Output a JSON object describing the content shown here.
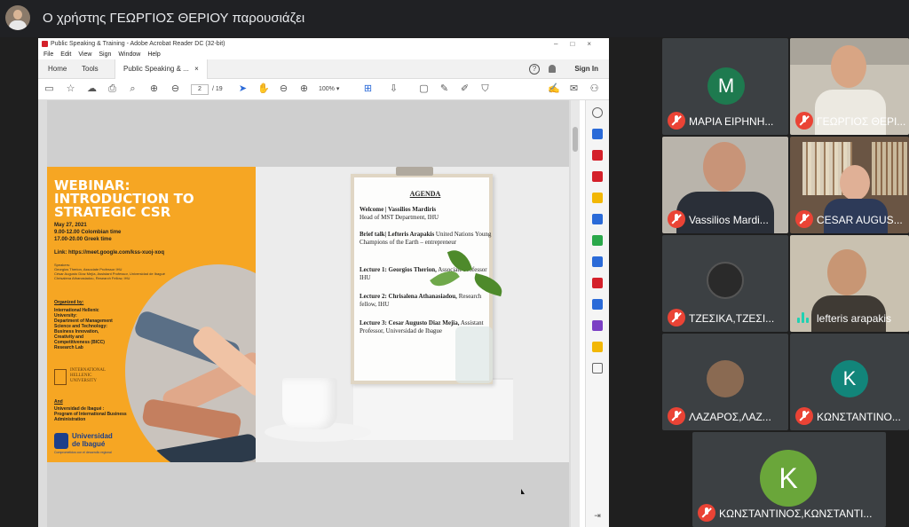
{
  "presenter": {
    "title": "Ο χρήστης ΓΕΩΡΓΙΟΣ ΘΕΡΙΟΥ παρουσιάζει"
  },
  "acrobat": {
    "window_title": "Public Speaking & Training - Adobe Acrobat Reader DC (32-bit)",
    "menu": [
      "File",
      "Edit",
      "View",
      "Sign",
      "Window",
      "Help"
    ],
    "tabs": {
      "home": "Home",
      "tools": "Tools",
      "doc": "Public Speaking & ...",
      "doc_close": "×"
    },
    "sign_in": "Sign In",
    "page_current": "2",
    "page_total": "/ 19",
    "zoom": "100%"
  },
  "poster": {
    "title_lines": [
      "WEBINAR:",
      "INTRODUCTION TO",
      "STRATEGIC CSR"
    ],
    "date": "May 27, 2021",
    "time1": "9.00-12.00 Colombian time",
    "time2": "17.00-20.00 Greek time",
    "link": "Link: https://meet.google.com/kss-xuoj-xoq",
    "speakers_lines": [
      "Speakers:",
      "Georgios Therion, Associate Professor IHU",
      "César Augusto Díaz Mejía, Assistant Professor, Universidad de Ibagué",
      "Chrisalena Athanasiadou, Research Fellow, IHU"
    ],
    "organized_by": "Organized by:",
    "org_lines": [
      "International Hellenic",
      "University:",
      "Department of Management",
      "Science  and Technology:",
      "Business Innovation,",
      "Creativity and",
      "Competitiveness (BICC)",
      "Research Lab"
    ],
    "ihu_logo_text": [
      "INTERNATIONAL",
      "HELLENIC",
      "UNIVERSITY"
    ],
    "and": "And",
    "and_lines": [
      "Universidad de Ibagué :",
      "Program of International Business",
      "Administration"
    ],
    "ibague_logo_text": [
      "Universidad",
      "de Ibagué"
    ],
    "ibague_tagline": "Comprometidos con el desarrollo regional"
  },
  "agenda": {
    "heading": "AGENDA",
    "items": [
      {
        "bold": "Welcome | Vassilios Mardiris",
        "rest": "Head of MST Department, IHU"
      },
      {
        "bold": "Brief talk| Lefteris Arapakis",
        "rest": "United Nations Young Champions of the Earth – entrepreneur"
      },
      {
        "bold": "Lecture 1: Georgios Therion,",
        "rest": "Associate Professor IHU"
      },
      {
        "bold": "Lecture 2: Chrisalena Athanasiadou,",
        "rest": "Research fellow, IHU"
      },
      {
        "bold": "Lecture 3: Cesar Augusto Diaz Mejia,",
        "rest": "Assistant Professor, Universidad de Ibague"
      }
    ]
  },
  "participants": [
    {
      "name": "ΜΑΡΙΑ ΕΙΡΗΝΗ...",
      "letter": "M",
      "avatar_color": "#1e7a4f",
      "muted": true
    },
    {
      "name": "ΓΕΩΡΓΙΟΣ ΘΕΡΙ...",
      "letter": "",
      "muted": true
    },
    {
      "name": "Vassilios Mardi...",
      "letter": "",
      "muted": true
    },
    {
      "name": "CESAR AUGUS...",
      "letter": "",
      "muted": true
    },
    {
      "name": "ΤΖΕΣΙΚΑ,ΤΖΕΣΙ...",
      "letter": "",
      "muted": true
    },
    {
      "name": "lefteris arapakis",
      "letter": "",
      "muted": false
    },
    {
      "name": "ΛΑΖΑΡΟΣ,ΛΑΖ...",
      "letter": "",
      "muted": true
    },
    {
      "name": "ΚΩΝΣΤΑΝΤΙΝΟ...",
      "letter": "K",
      "avatar_color": "#12857a",
      "muted": true
    },
    {
      "name": "ΚΩΝΣΤΑΝΤΙΝΟΣ,ΚΩΝΣΤΑΝΤΙ...",
      "letter": "K",
      "avatar_color": "#6aa63a",
      "muted": true
    }
  ]
}
